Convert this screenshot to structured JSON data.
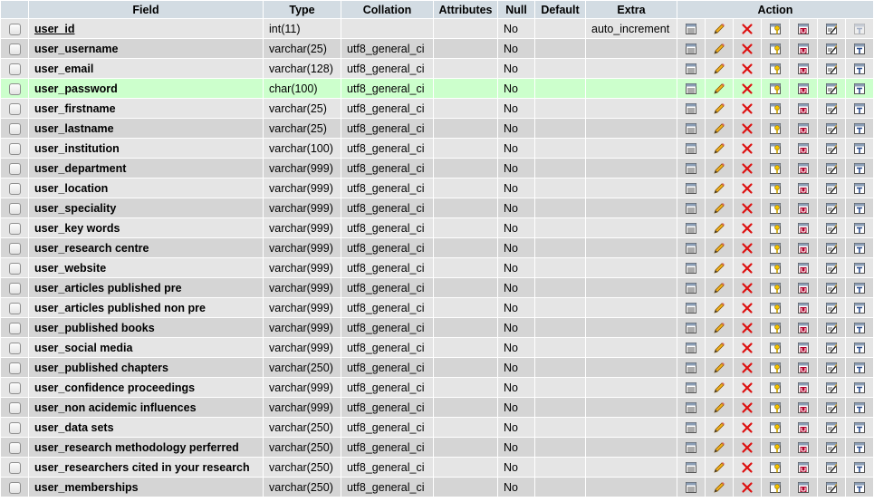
{
  "headers": {
    "field": "Field",
    "type": "Type",
    "collation": "Collation",
    "attributes": "Attributes",
    "null": "Null",
    "default": "Default",
    "extra": "Extra",
    "action": "Action"
  },
  "action_icons": [
    "browse-icon",
    "edit-icon",
    "drop-icon",
    "primary-key-icon",
    "unique-icon",
    "index-icon",
    "fulltext-icon"
  ],
  "colors": {
    "header": "#d3dce3",
    "row_odd": "#e5e5e5",
    "row_even": "#d5d5d5",
    "row_highlight": "#ccffcc"
  },
  "rows": [
    {
      "field": "user_id",
      "type": "int(11)",
      "collation": "",
      "attributes": "",
      "null": "No",
      "default": "",
      "extra": "auto_increment",
      "primary": true
    },
    {
      "field": "user_username",
      "type": "varchar(25)",
      "collation": "utf8_general_ci",
      "attributes": "",
      "null": "No",
      "default": "",
      "extra": ""
    },
    {
      "field": "user_email",
      "type": "varchar(128)",
      "collation": "utf8_general_ci",
      "attributes": "",
      "null": "No",
      "default": "",
      "extra": ""
    },
    {
      "field": "user_password",
      "type": "char(100)",
      "collation": "utf8_general_ci",
      "attributes": "",
      "null": "No",
      "default": "",
      "extra": "",
      "highlight": true
    },
    {
      "field": "user_firstname",
      "type": "varchar(25)",
      "collation": "utf8_general_ci",
      "attributes": "",
      "null": "No",
      "default": "",
      "extra": ""
    },
    {
      "field": "user_lastname",
      "type": "varchar(25)",
      "collation": "utf8_general_ci",
      "attributes": "",
      "null": "No",
      "default": "",
      "extra": ""
    },
    {
      "field": "user_institution",
      "type": "varchar(100)",
      "collation": "utf8_general_ci",
      "attributes": "",
      "null": "No",
      "default": "",
      "extra": ""
    },
    {
      "field": "user_department",
      "type": "varchar(999)",
      "collation": "utf8_general_ci",
      "attributes": "",
      "null": "No",
      "default": "",
      "extra": ""
    },
    {
      "field": "user_location",
      "type": "varchar(999)",
      "collation": "utf8_general_ci",
      "attributes": "",
      "null": "No",
      "default": "",
      "extra": ""
    },
    {
      "field": "user_speciality",
      "type": "varchar(999)",
      "collation": "utf8_general_ci",
      "attributes": "",
      "null": "No",
      "default": "",
      "extra": ""
    },
    {
      "field": "user_key words",
      "type": "varchar(999)",
      "collation": "utf8_general_ci",
      "attributes": "",
      "null": "No",
      "default": "",
      "extra": ""
    },
    {
      "field": "user_research centre",
      "type": "varchar(999)",
      "collation": "utf8_general_ci",
      "attributes": "",
      "null": "No",
      "default": "",
      "extra": ""
    },
    {
      "field": "user_website",
      "type": "varchar(999)",
      "collation": "utf8_general_ci",
      "attributes": "",
      "null": "No",
      "default": "",
      "extra": ""
    },
    {
      "field": "user_articles published pre",
      "type": "varchar(999)",
      "collation": "utf8_general_ci",
      "attributes": "",
      "null": "No",
      "default": "",
      "extra": ""
    },
    {
      "field": "user_articles published non pre",
      "type": "varchar(999)",
      "collation": "utf8_general_ci",
      "attributes": "",
      "null": "No",
      "default": "",
      "extra": ""
    },
    {
      "field": "user_published books",
      "type": "varchar(999)",
      "collation": "utf8_general_ci",
      "attributes": "",
      "null": "No",
      "default": "",
      "extra": ""
    },
    {
      "field": "user_social media",
      "type": "varchar(999)",
      "collation": "utf8_general_ci",
      "attributes": "",
      "null": "No",
      "default": "",
      "extra": ""
    },
    {
      "field": "user_published chapters",
      "type": "varchar(250)",
      "collation": "utf8_general_ci",
      "attributes": "",
      "null": "No",
      "default": "",
      "extra": ""
    },
    {
      "field": "user_confidence proceedings",
      "type": "varchar(999)",
      "collation": "utf8_general_ci",
      "attributes": "",
      "null": "No",
      "default": "",
      "extra": ""
    },
    {
      "field": "user_non acidemic influences",
      "type": "varchar(999)",
      "collation": "utf8_general_ci",
      "attributes": "",
      "null": "No",
      "default": "",
      "extra": ""
    },
    {
      "field": "user_data sets",
      "type": "varchar(250)",
      "collation": "utf8_general_ci",
      "attributes": "",
      "null": "No",
      "default": "",
      "extra": ""
    },
    {
      "field": "user_research methodology perferred",
      "type": "varchar(250)",
      "collation": "utf8_general_ci",
      "attributes": "",
      "null": "No",
      "default": "",
      "extra": ""
    },
    {
      "field": "user_researchers cited in your research",
      "type": "varchar(250)",
      "collation": "utf8_general_ci",
      "attributes": "",
      "null": "No",
      "default": "",
      "extra": ""
    },
    {
      "field": "user_memberships",
      "type": "varchar(250)",
      "collation": "utf8_general_ci",
      "attributes": "",
      "null": "No",
      "default": "",
      "extra": ""
    }
  ]
}
